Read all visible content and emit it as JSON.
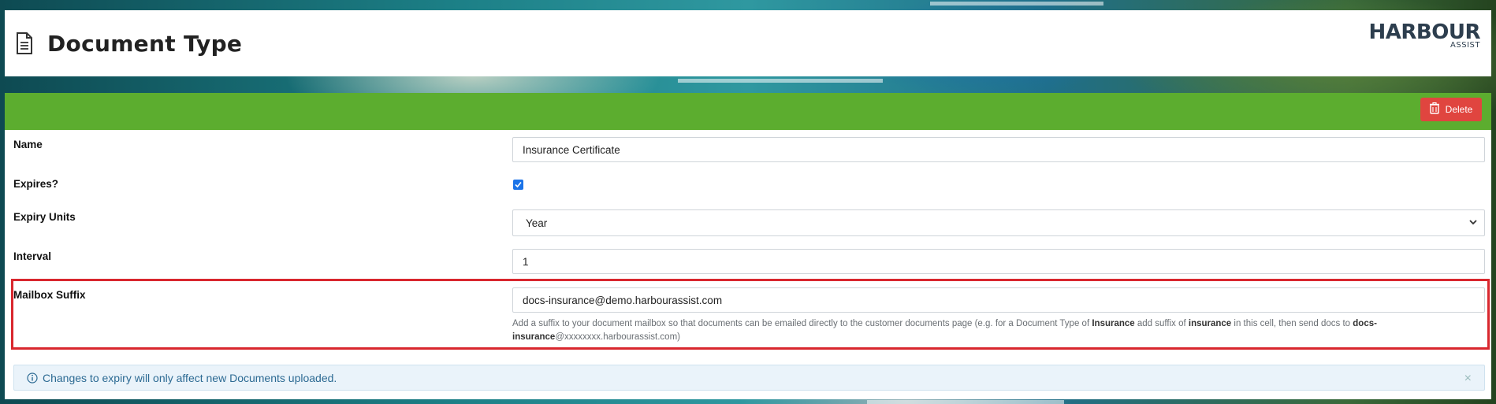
{
  "header": {
    "title": "Document Type",
    "logo_main": "HARBOUR",
    "logo_sub": "ASSIST"
  },
  "toolbar": {
    "delete_label": "Delete",
    "delete_color": "#e0453f",
    "bar_color": "#5cad2f"
  },
  "form": {
    "name_label": "Name",
    "name_value": "Insurance Certificate",
    "expires_label": "Expires?",
    "expires_checked": true,
    "expiry_units_label": "Expiry Units",
    "expiry_units_value": "Year",
    "interval_label": "Interval",
    "interval_value": "1",
    "mailbox_label": "Mailbox Suffix",
    "mailbox_value": "docs-insurance@demo.harbourassist.com",
    "help": {
      "part1": "Add a suffix to your document mailbox so that documents can be emailed directly to the customer documents page (e.g. for a Document Type of ",
      "bold1": "Insurance",
      "part2": " add suffix of ",
      "bold2": "insurance",
      "part3": " in this cell, then send docs to ",
      "bold3": "docs-insurance",
      "part4": "@xxxxxxxx.harbourassist.com)"
    }
  },
  "alert": {
    "icon": "info-icon",
    "text": "Changes to expiry will only affect new Documents uploaded.",
    "close": "×"
  }
}
